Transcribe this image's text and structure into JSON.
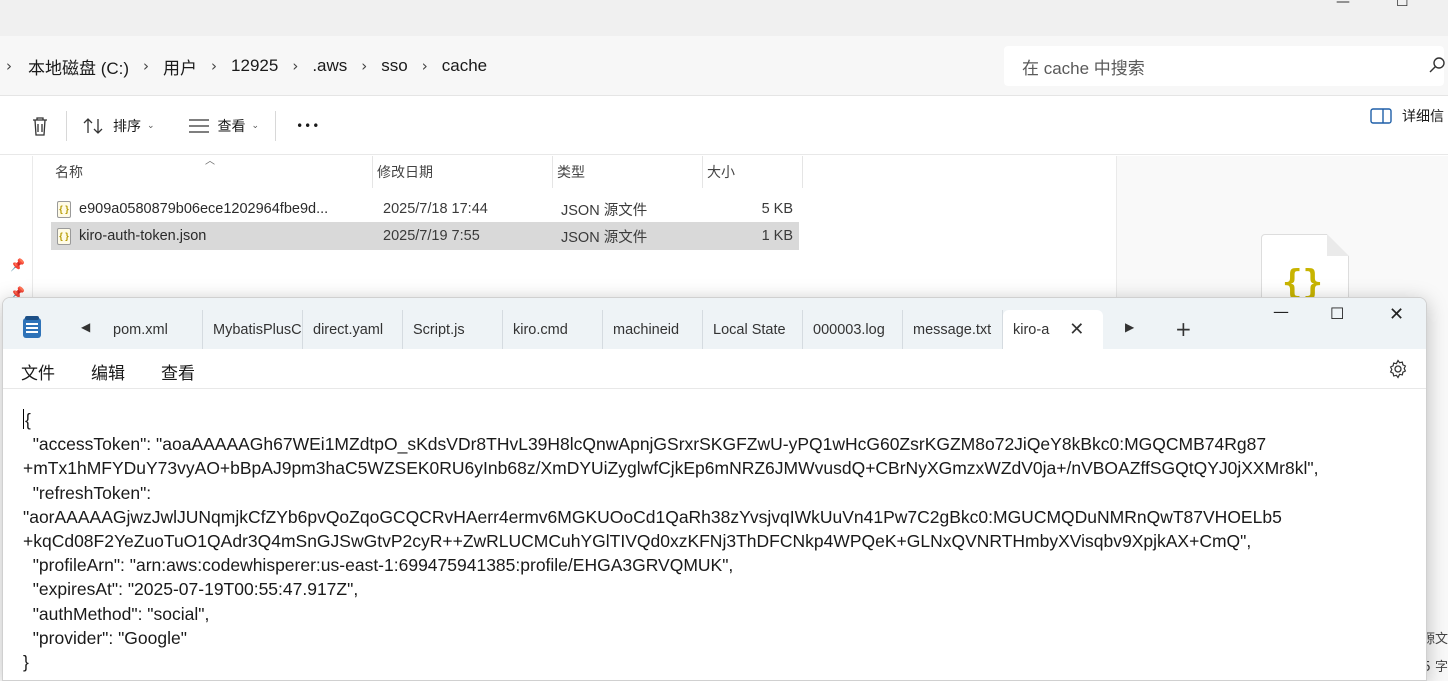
{
  "explorer": {
    "breadcrumb": [
      "本地磁盘 (C:)",
      "用户",
      "12925",
      ".aws",
      "sso",
      "cache"
    ],
    "search_placeholder": "在 cache 中搜索",
    "toolbar": {
      "sort_label": "排序",
      "view_label": "查看",
      "more_label": "•••",
      "details_label": "详细信"
    },
    "columns": [
      "名称",
      "修改日期",
      "类型",
      "大小"
    ],
    "files": [
      {
        "name": "e909a0580879b06ece1202964fbe9d...",
        "date": "2025/7/18 17:44",
        "type": "JSON 源文件",
        "size": "5 KB",
        "selected": false
      },
      {
        "name": "kiro-auth-token.json",
        "date": "2025/7/19 7:55",
        "type": "JSON 源文件",
        "size": "1 KB",
        "selected": true
      }
    ],
    "preview_side_text": [
      "源文",
      "5 字"
    ]
  },
  "notepad": {
    "tabs": [
      {
        "label": "pom.xml"
      },
      {
        "label": "MybatisPlusC"
      },
      {
        "label": "direct.yaml"
      },
      {
        "label": "Script.js"
      },
      {
        "label": "kiro.cmd"
      },
      {
        "label": "machineid"
      },
      {
        "label": "Local State"
      },
      {
        "label": "000003.log"
      },
      {
        "label": "message.txt"
      },
      {
        "label": "kiro-a"
      }
    ],
    "active_tab": "kiro-a",
    "menu": [
      "文件",
      "编辑",
      "查看"
    ],
    "content_lines": [
      "{",
      "  \"accessToken\": \"aoaAAAAAGh67WEi1MZdtpO_sKdsVDr8THvL39H8lcQnwApnjGSrxrSKGFZwU-yPQ1wHcG60ZsrKGZM8o72JiQeY8kBkc0:MGQCMB74Rg87",
      "+mTx1hMFYDuY73vyAO+bBpAJ9pm3haC5WZSEK0RU6yInb68z/XmDYUiZyglwfCjkEp6mNRZ6JMWvusdQ+CBrNyXGmzxWZdV0ja+/nVBOAZffSGQtQYJ0jXXMr8kl\",",
      "  \"refreshToken\":",
      "\"aorAAAAAGjwzJwlJUNqmjkCfZYb6pvQoZqoGCQCRvHAerr4ermv6MGKUOoCd1QaRh38zYvsjvqIWkUuVn41Pw7C2gBkc0:MGUCMQDuNMRnQwT87VHOELb5",
      "+kqCd08F2YeZuoTuO1QAdr3Q4mSnGJSwGtvP2cyR++ZwRLUCMCuhYGlTIVQd0xzKFNj3ThDFCNkp4WPQeK+GLNxQVNRTHmbyXVisqbv9XpjkAX+CmQ\",",
      "  \"profileArn\": \"arn:aws:codewhisperer:us-east-1:699475941385:profile/EHGA3GRVQMUK\",",
      "  \"expiresAt\": \"2025-07-19T00:55:47.917Z\",",
      "  \"authMethod\": \"social\",",
      "  \"provider\": \"Google\"",
      "}"
    ]
  },
  "colors": {
    "selection": "#d9d9d9",
    "notepad_titlebar": "#eef3f6",
    "json_icon": "#c8b400",
    "app_icon": "#2f73b8"
  }
}
